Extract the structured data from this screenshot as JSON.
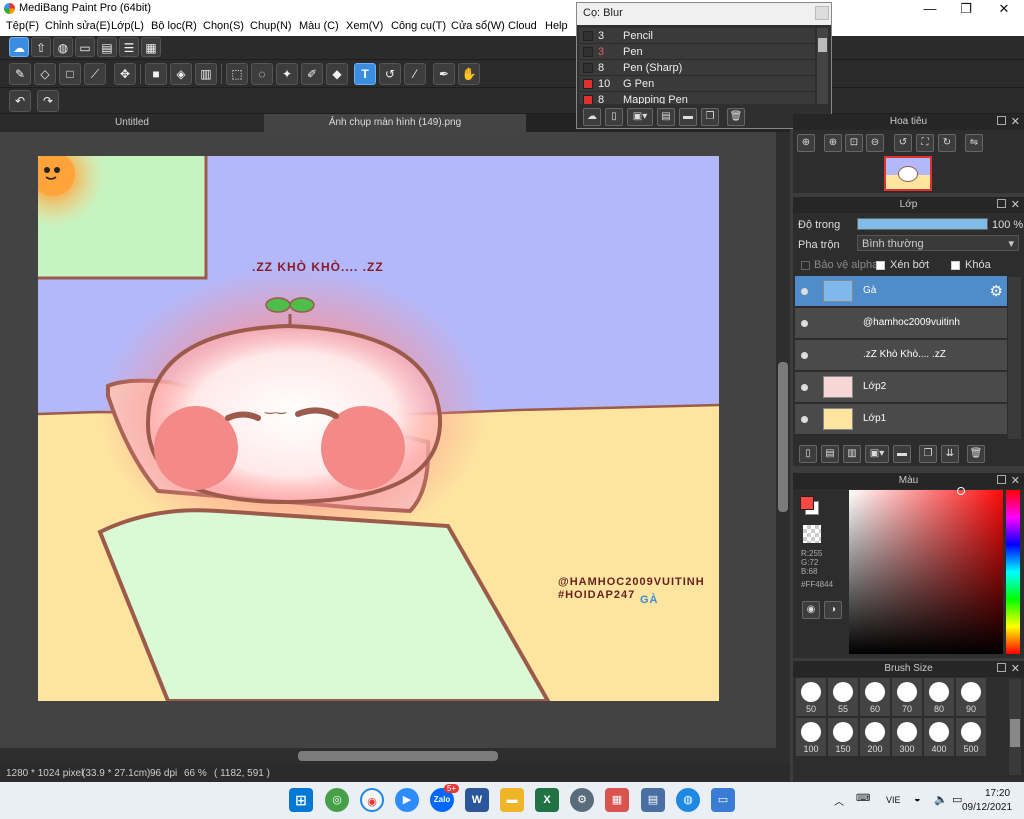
{
  "window": {
    "title": "MediBang Paint Pro (64bit)",
    "min": "—",
    "max": "❐",
    "close": "✕"
  },
  "menu": [
    "Tệp(F)",
    "Chỉnh sửa(E)",
    "Lớp(L)",
    "Bộ lọc(R)",
    "Chọn(S)",
    "Chụp(N)",
    "Màu (C)",
    "Xem(V)",
    "Công cụ(T)",
    "Cửa sổ(W)",
    "Cloud",
    "Help"
  ],
  "brush_popup": {
    "title": "Cọ: Blur",
    "items": [
      {
        "size": "3",
        "name": "Pencil",
        "color": "#303030"
      },
      {
        "size": "3",
        "name": "Pen",
        "color": "#303030",
        "dim": true
      },
      {
        "size": "8",
        "name": "Pen (Sharp)",
        "color": "#303030"
      },
      {
        "size": "10",
        "name": "G Pen",
        "color": "#e03030"
      },
      {
        "size": "8",
        "name": "Mapping Pen",
        "color": "#e03030"
      }
    ]
  },
  "tabs": [
    "Untitled",
    "Ảnh chụp màn hình (149).png"
  ],
  "artwork": {
    "text_sleep": ".ZZ KHÒ KHÒ.... .ZZ",
    "text_handle": "@HAMHOC2009VUITINH",
    "text_tag": "#HOIDAP247",
    "text_name": "GÀ",
    "face_mouth": "‿‿"
  },
  "status": {
    "size": "1280 * 1024 pixel",
    "cm": "(33.9 * 27.1cm)",
    "dpi": "96 dpi",
    "zoom": "66 %",
    "coords": "( 1182, 591 )"
  },
  "navigator": {
    "title": "Hoa tiêu"
  },
  "layers_panel": {
    "title": "Lớp",
    "opacity_label": "Độ trong",
    "opacity_value": "100 %",
    "opacity": 1.0,
    "blend_label": "Pha trộn",
    "blend_value": "Bình thường",
    "protect_alpha": "Bảo vệ alpha",
    "clipping": "Xén bớt",
    "lock": "Khóa",
    "layers": [
      {
        "name": "Gà",
        "selected": true
      },
      {
        "name": "@hamhoc2009vuitinh",
        "selected": false
      },
      {
        "name": ".zZ Khò Khò.... .zZ",
        "selected": false
      },
      {
        "name": "Lớp2",
        "selected": false
      },
      {
        "name": "Lớp1",
        "selected": false
      }
    ]
  },
  "color_panel": {
    "title": "Màu",
    "r": "R:255",
    "g": "G:72",
    "b": "B:68",
    "hex": "#FF4844",
    "color": "#ff4844"
  },
  "brush_size_panel": {
    "title": "Brush Size",
    "sizes": [
      "50",
      "55",
      "60",
      "70",
      "80",
      "90",
      "100",
      "150",
      "200",
      "300",
      "400",
      "500"
    ]
  },
  "taskbar": {
    "time": "17:20",
    "date": "09/12/2021",
    "lang": "VIE",
    "badge": "5+"
  }
}
